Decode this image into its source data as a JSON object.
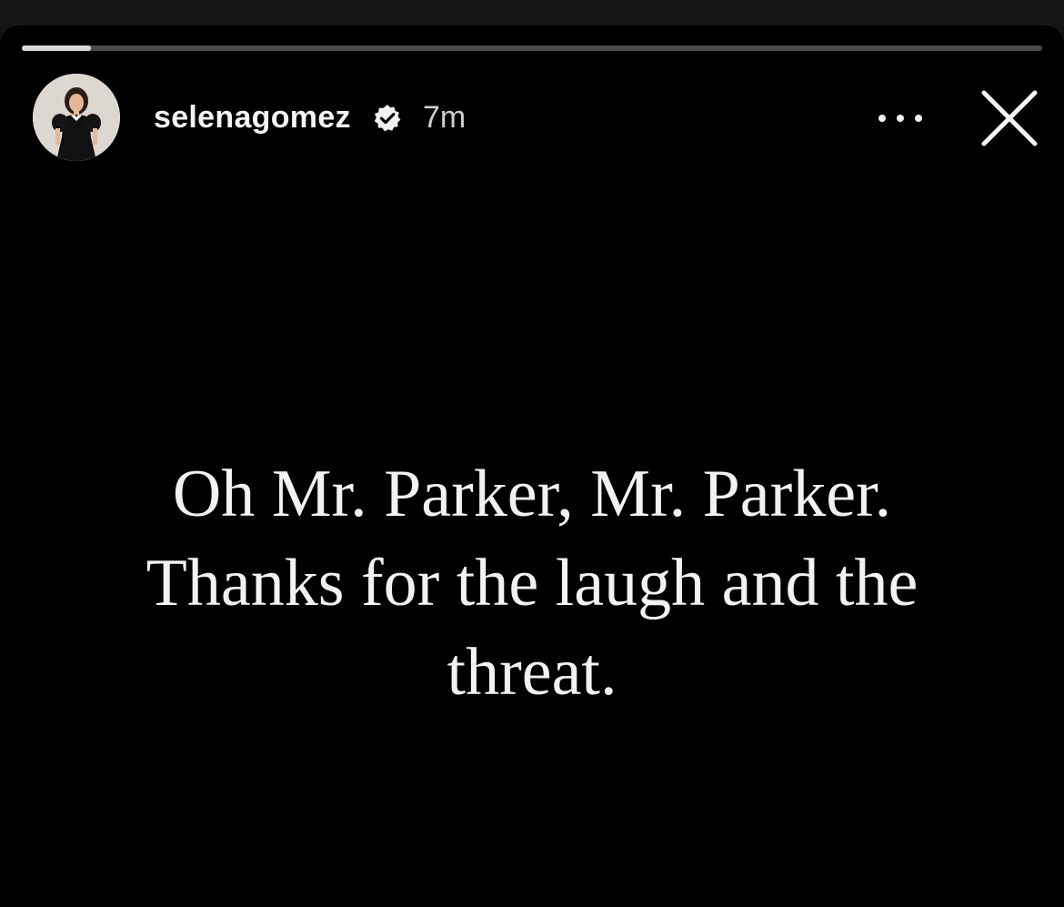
{
  "story": {
    "username": "selenagomez",
    "timestamp": "7m",
    "verified": true,
    "progress": 0.068,
    "text_lines": [
      "Oh Mr. Parker, Mr. Parker.",
      "Thanks for the laugh and the",
      "threat."
    ],
    "icons": {
      "avatar": "profile-photo",
      "verified": "verified-badge-icon",
      "more": "more-options-icon",
      "close": "close-icon"
    }
  },
  "colors": {
    "background": "#000000",
    "text": "#f2f2f2",
    "progress_track": "#4a4a4a",
    "progress_fill": "#d9d9d9"
  }
}
